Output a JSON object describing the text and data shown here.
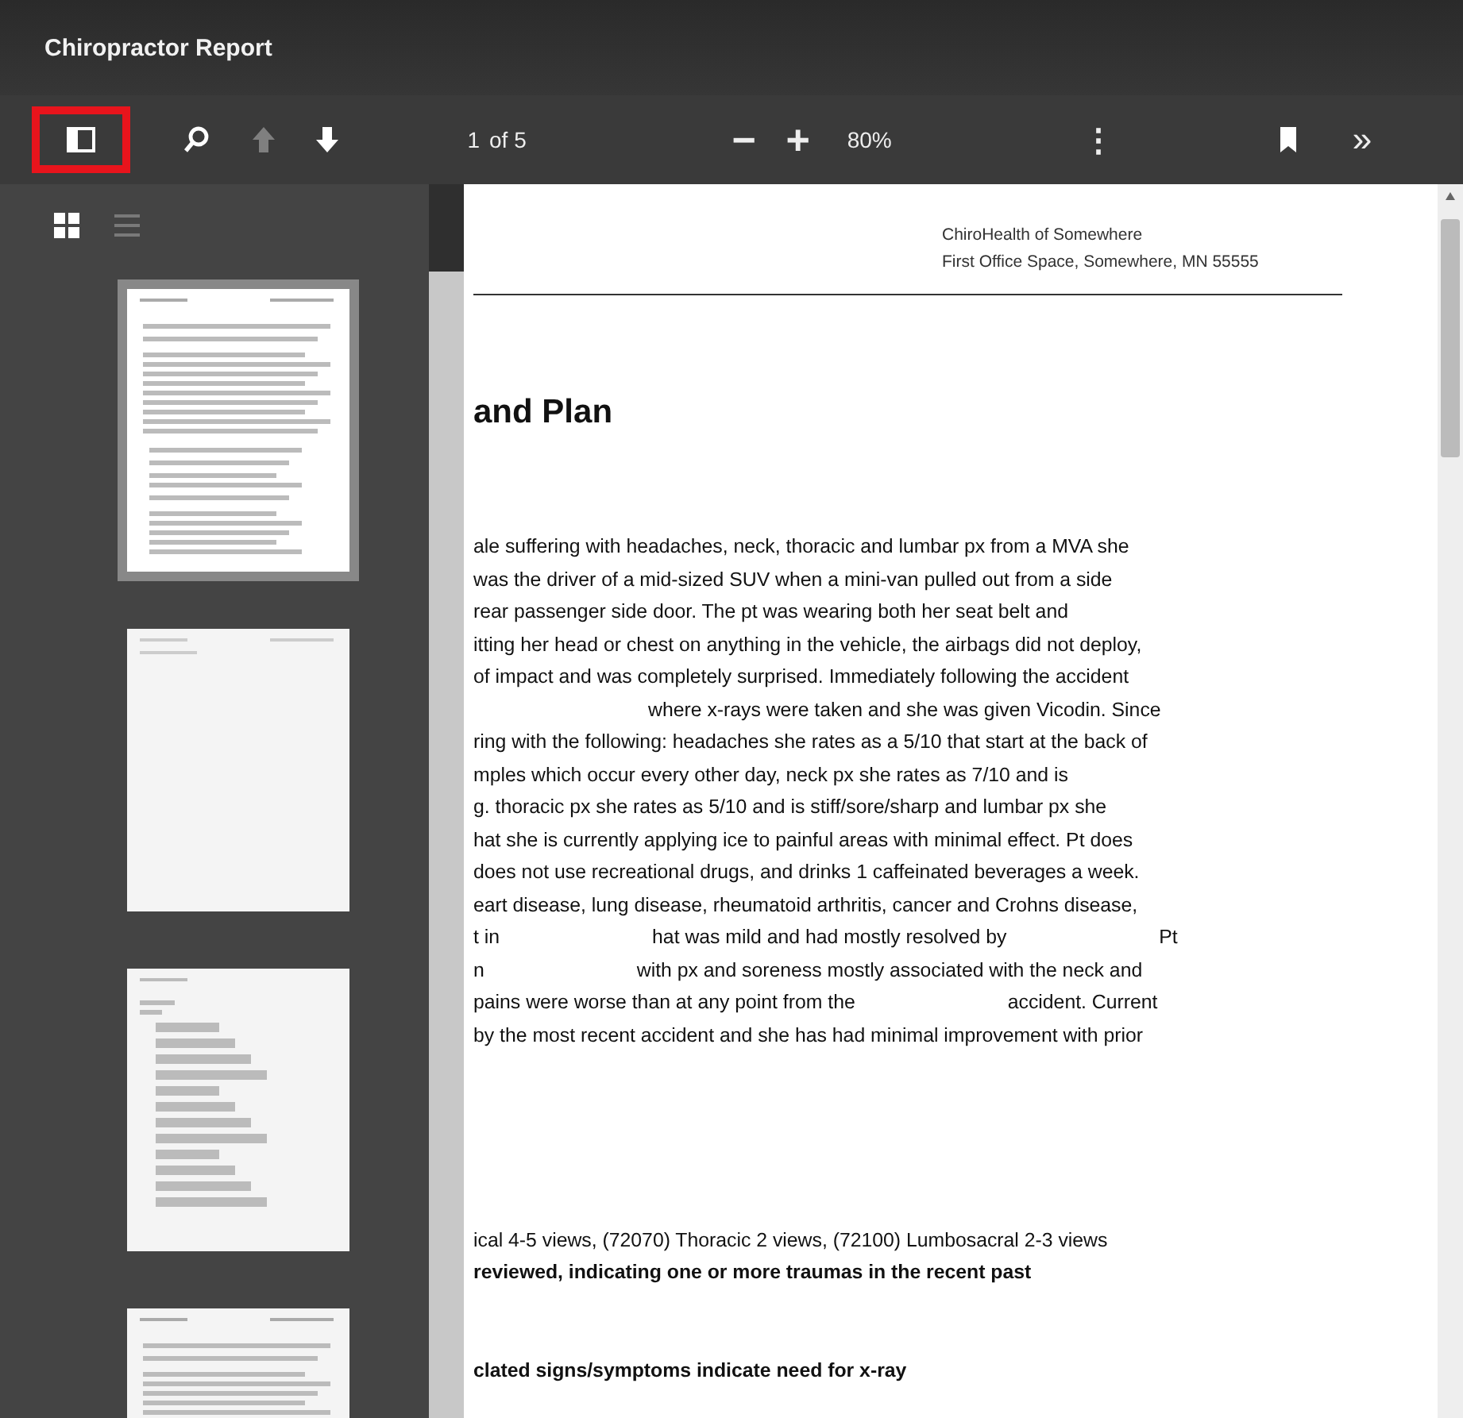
{
  "window": {
    "title": "Chiropractor Report"
  },
  "toolbar": {
    "sidebar_toggle": {
      "highlighted": true
    },
    "prev_disabled": true,
    "page": {
      "value": "1",
      "total": "of 5"
    },
    "zoom_out": "−",
    "zoom_in": "+",
    "zoom": "80%",
    "more": "⋮",
    "next_tools": "»"
  },
  "sidebar": {
    "views": [
      {
        "kind": "grid",
        "selected": true
      },
      {
        "kind": "list",
        "selected": false
      }
    ],
    "thumbnails": [
      {
        "kind": "text",
        "selected": true
      },
      {
        "kind": "blank",
        "selected": false
      },
      {
        "kind": "list",
        "selected": false
      },
      {
        "kind": "text",
        "selected": false
      }
    ]
  },
  "document": {
    "letterhead": [
      "ChiroHealth of Somewhere",
      "First Office Space, Somewhere, MN 55555"
    ],
    "heading": "and Plan",
    "paragraph": [
      {
        "lead_blank": false,
        "pieces": [
          "ale suffering with headaches, neck, thoracic and lumbar px from a MVA she"
        ]
      },
      {
        "lead_blank": false,
        "pieces": [
          "was the driver of a mid-sized SUV when a mini-van pulled out from a side"
        ]
      },
      {
        "lead_blank": false,
        "pieces": [
          "rear passenger side door. The pt was wearing both her seat belt and"
        ]
      },
      {
        "lead_blank": false,
        "pieces": [
          "itting her head or chest on anything in the vehicle, the airbags did not deploy,"
        ]
      },
      {
        "lead_blank": false,
        "pieces": [
          "of impact and was completely surprised. Immediately following the accident"
        ]
      },
      {
        "lead_blank": true,
        "pieces": [
          "where x-rays were taken and she was given Vicodin. Since"
        ]
      },
      {
        "lead_blank": false,
        "pieces": [
          "ring with the following: headaches she rates as a 5/10 that start at the back of"
        ]
      },
      {
        "lead_blank": false,
        "pieces": [
          "mples which occur every other day, neck px she rates as 7/10 and is"
        ]
      },
      {
        "lead_blank": false,
        "pieces": [
          "g. thoracic px she rates as 5/10 and is stiff/sore/sharp and lumbar px she"
        ]
      },
      {
        "lead_blank": false,
        "pieces": [
          "hat she is currently applying ice to painful areas with minimal effect. Pt does"
        ]
      },
      {
        "lead_blank": false,
        "pieces": [
          "does not use recreational drugs, and drinks 1 caffeinated beverages a week."
        ]
      },
      {
        "lead_blank": false,
        "pieces": [
          "eart disease, lung disease, rheumatoid arthritis, cancer and Crohns disease,"
        ]
      },
      {
        "lead_blank": false,
        "pieces": [
          "t in",
          "hat was mild and had mostly resolved by",
          "Pt"
        ]
      },
      {
        "lead_blank": false,
        "pieces": [
          "n",
          "with px and soreness mostly associated with the neck and"
        ]
      },
      {
        "lead_blank": false,
        "pieces": [
          "pains were worse than at any point from the",
          "accident. Current"
        ]
      },
      {
        "lead_blank": false,
        "pieces": [
          "by the most recent accident and she has had minimal improvement with prior"
        ]
      }
    ],
    "xray": [
      {
        "kind": "plain",
        "text": "ical 4-5 views, (72070) Thoracic 2 views, (72100) Lumbosacral 2-3 views"
      },
      {
        "kind": "bold",
        "text": "reviewed, indicating one or more traumas in the recent past"
      }
    ],
    "indication": "clated signs/symptoms indicate need for x-ray"
  }
}
